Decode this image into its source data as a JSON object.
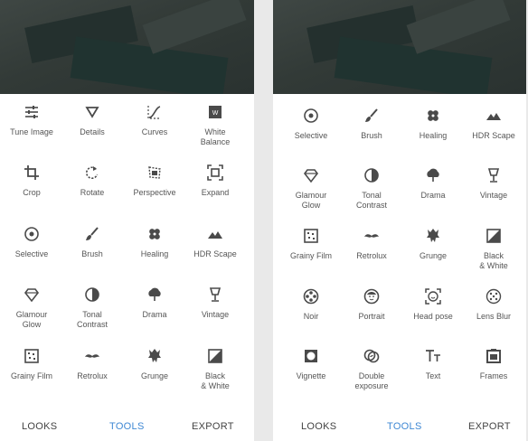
{
  "left": {
    "tools": [
      {
        "label": "Tune Image",
        "icon": "tune-icon"
      },
      {
        "label": "Details",
        "icon": "details-triangle-icon"
      },
      {
        "label": "Curves",
        "icon": "curves-icon"
      },
      {
        "label": "White\nBalance",
        "icon": "white-balance-icon"
      },
      {
        "label": "Crop",
        "icon": "crop-icon"
      },
      {
        "label": "Rotate",
        "icon": "rotate-icon"
      },
      {
        "label": "Perspective",
        "icon": "perspective-icon"
      },
      {
        "label": "Expand",
        "icon": "expand-icon"
      },
      {
        "label": "Selective",
        "icon": "selective-icon"
      },
      {
        "label": "Brush",
        "icon": "brush-icon"
      },
      {
        "label": "Healing",
        "icon": "healing-icon"
      },
      {
        "label": "HDR Scape",
        "icon": "hdr-scape-icon"
      },
      {
        "label": "Glamour\nGlow",
        "icon": "glamour-glow-icon"
      },
      {
        "label": "Tonal\nContrast",
        "icon": "tonal-contrast-icon"
      },
      {
        "label": "Drama",
        "icon": "drama-icon"
      },
      {
        "label": "Vintage",
        "icon": "vintage-icon"
      },
      {
        "label": "Grainy Film",
        "icon": "grainy-film-icon"
      },
      {
        "label": "Retrolux",
        "icon": "retrolux-icon"
      },
      {
        "label": "Grunge",
        "icon": "grunge-icon"
      },
      {
        "label": "Black\n& White",
        "icon": "black-white-icon"
      }
    ],
    "nav": {
      "looks": "LOOKS",
      "tools": "TOOLS",
      "export": "EXPORT"
    }
  },
  "right": {
    "tools": [
      {
        "label": "Selective",
        "icon": "selective-icon"
      },
      {
        "label": "Brush",
        "icon": "brush-icon"
      },
      {
        "label": "Healing",
        "icon": "healing-icon"
      },
      {
        "label": "HDR Scape",
        "icon": "hdr-scape-icon"
      },
      {
        "label": "Glamour\nGlow",
        "icon": "glamour-glow-icon"
      },
      {
        "label": "Tonal\nContrast",
        "icon": "tonal-contrast-icon"
      },
      {
        "label": "Drama",
        "icon": "drama-icon"
      },
      {
        "label": "Vintage",
        "icon": "vintage-icon"
      },
      {
        "label": "Grainy Film",
        "icon": "grainy-film-icon"
      },
      {
        "label": "Retrolux",
        "icon": "retrolux-icon"
      },
      {
        "label": "Grunge",
        "icon": "grunge-icon"
      },
      {
        "label": "Black\n& White",
        "icon": "black-white-icon"
      },
      {
        "label": "Noir",
        "icon": "noir-icon"
      },
      {
        "label": "Portrait",
        "icon": "portrait-icon"
      },
      {
        "label": "Head pose",
        "icon": "head-pose-icon"
      },
      {
        "label": "Lens Blur",
        "icon": "lens-blur-icon"
      },
      {
        "label": "Vignette",
        "icon": "vignette-icon"
      },
      {
        "label": "Double\nexposure",
        "icon": "double-exposure-icon"
      },
      {
        "label": "Text",
        "icon": "text-icon"
      },
      {
        "label": "Frames",
        "icon": "frames-icon"
      }
    ],
    "nav": {
      "looks": "LOOKS",
      "tools": "TOOLS",
      "export": "EXPORT"
    }
  },
  "colors": {
    "active_tab": "#3f88d4",
    "icon": "#4a4a4a",
    "label": "#555555"
  }
}
